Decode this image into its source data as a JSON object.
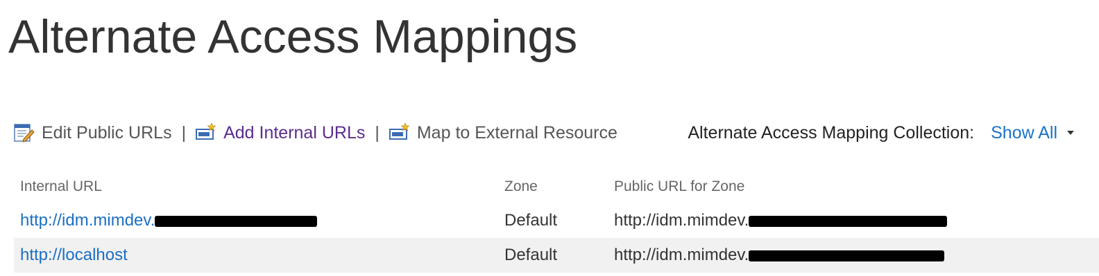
{
  "title": "Alternate Access Mappings",
  "toolbar": {
    "edit_label": "Edit Public URLs",
    "add_label": "Add Internal URLs",
    "map_label": "Map to External Resource",
    "separator": "|"
  },
  "collection": {
    "label": "Alternate Access Mapping Collection:",
    "value": "Show All"
  },
  "table": {
    "headers": {
      "internal": "Internal URL",
      "zone": "Zone",
      "public": "Public URL for Zone"
    },
    "rows": [
      {
        "internal": "http://idm.mimdev.",
        "zone": "Default",
        "public": "http://idm.mimdev."
      },
      {
        "internal": "http://localhost",
        "zone": "Default",
        "public": "http://idm.mimdev."
      }
    ]
  },
  "colors": {
    "link": "#1a6fc4",
    "visited_link": "#5b2c8f",
    "row_alt_bg": "#f1f1f1",
    "redaction": "#000000"
  },
  "icons": [
    "edit-document-icon",
    "add-internal-url-icon",
    "map-external-resource-icon",
    "dropdown-caret-icon"
  ]
}
